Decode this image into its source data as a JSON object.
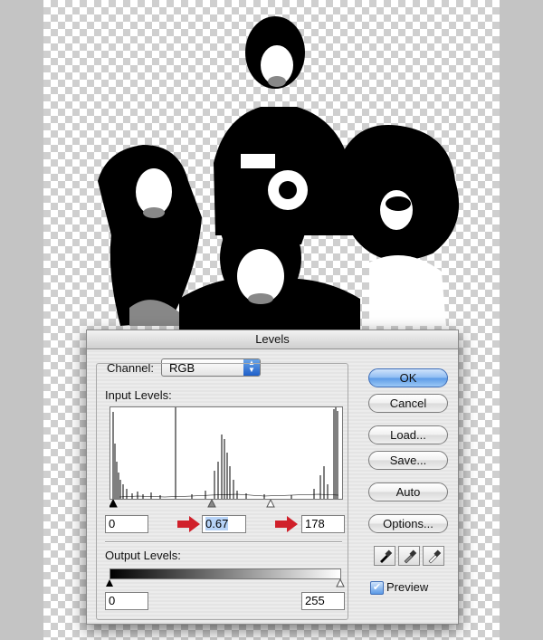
{
  "dialog": {
    "title": "Levels",
    "channel_label": "Channel:",
    "channel_value": "RGB",
    "input_levels_label": "Input Levels:",
    "input_black": "0",
    "input_gamma": "0.67",
    "input_white": "178",
    "output_levels_label": "Output Levels:",
    "output_black": "0",
    "output_white": "255",
    "buttons": {
      "ok": "OK",
      "cancel": "Cancel",
      "load": "Load...",
      "save": "Save...",
      "auto": "Auto",
      "options": "Options..."
    },
    "preview_label": "Preview",
    "preview_checked": true
  },
  "annotation_arrow_color": "#d0202a",
  "accent_color": "#5b9ae6"
}
